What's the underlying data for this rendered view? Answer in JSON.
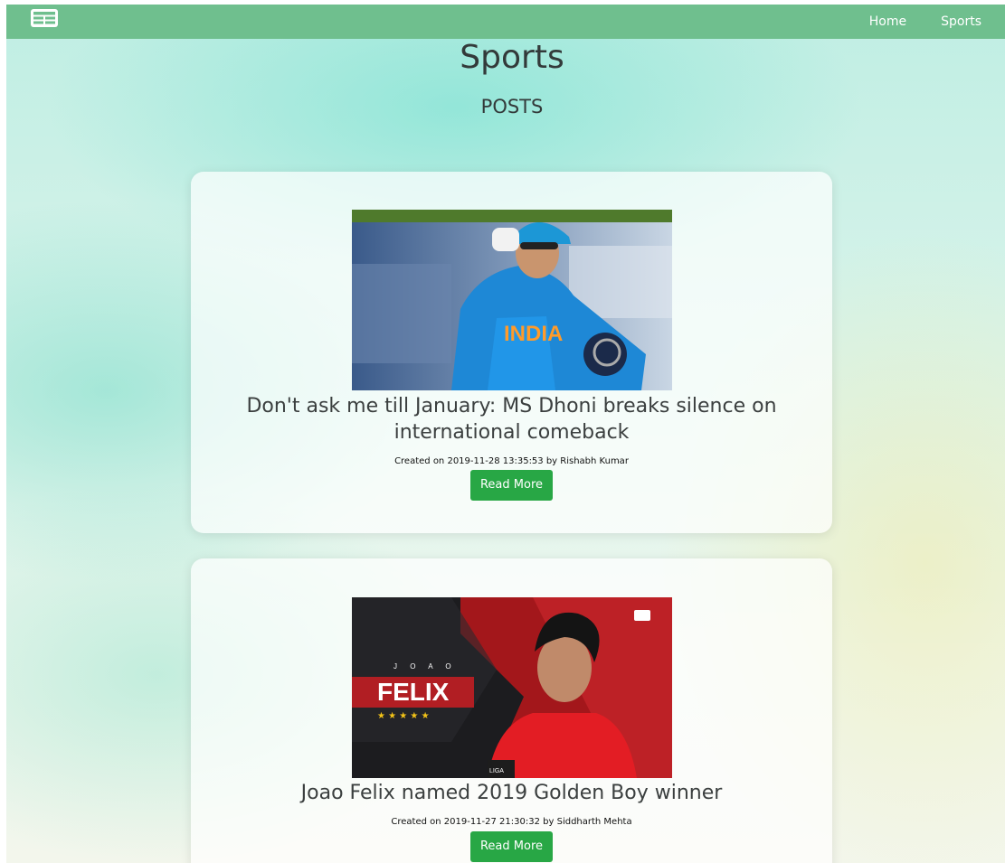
{
  "navbar": {
    "brand_icon": "newspaper-icon",
    "links": [
      {
        "label": "Home"
      },
      {
        "label": "Sports"
      }
    ]
  },
  "page": {
    "title": "Sports",
    "section_title": "POSTS"
  },
  "posts": [
    {
      "title": "Don't ask me till January: MS Dhoni breaks silence on international comeback",
      "meta": "Created on 2019-11-28 13:35:53 by Rishabh Kumar",
      "read_more_label": "Read More",
      "image_text": "INDIA"
    },
    {
      "title": "Joao Felix named 2019 Golden Boy winner",
      "meta": "Created on 2019-11-27 21:30:32 by Siddharth Mehta",
      "read_more_label": "Read More",
      "image_text_small": "J O A O",
      "image_text_big": "FELIX",
      "image_text_badge": "LIGA"
    }
  ],
  "colors": {
    "navbar": "#6fbf8e",
    "button": "#28a745"
  }
}
